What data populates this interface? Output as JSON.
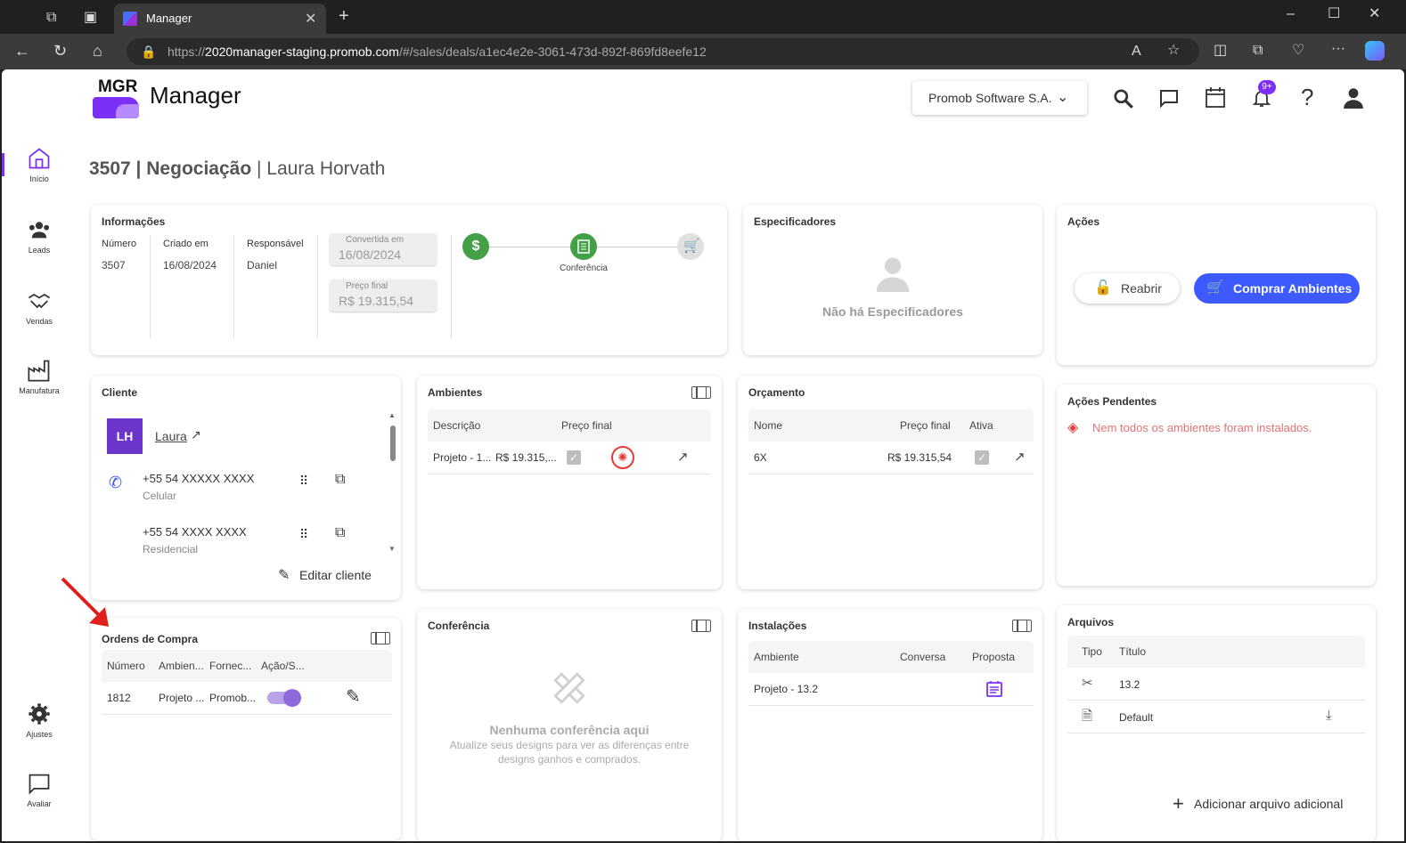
{
  "browser": {
    "tab_title": "Manager",
    "url_prefix": "https://",
    "url_host": "2020manager-staging.promob.com",
    "url_path": "/#/sales/deals/a1ec4e2e-3061-473d-892f-869fd8eefe12"
  },
  "header": {
    "logo_text": "MGR",
    "app_name": "Manager",
    "company": "Promob Software S.A.",
    "notif_badge": "9+"
  },
  "sidebar": {
    "items": [
      {
        "label": "Início"
      },
      {
        "label": "Leads"
      },
      {
        "label": "Vendas"
      },
      {
        "label": "Manufatura"
      },
      {
        "label": "Ajustes"
      },
      {
        "label": "Avaliar"
      }
    ]
  },
  "page": {
    "id": "3507",
    "type": "Negociação",
    "client": "Laura Horvath"
  },
  "info": {
    "title": "Informações",
    "labels": {
      "numero": "Número",
      "criado": "Criado em",
      "responsavel": "Responsável"
    },
    "values": {
      "numero": "3507",
      "criado": "16/08/2024",
      "responsavel": "Daniel"
    },
    "convertida_label": "Convertida em",
    "convertida_value": "16/08/2024",
    "preco_label": "Preço final",
    "preco_value": "R$ 19.315,54",
    "stage_label": "Conferência"
  },
  "especificadores": {
    "title": "Especificadores",
    "empty": "Não há Especificadores"
  },
  "acoes": {
    "title": "Ações",
    "reabrir": "Reabrir",
    "comprar": "Comprar Ambientes"
  },
  "cliente": {
    "title": "Cliente",
    "initials": "LH",
    "name": "Laura",
    "phones": [
      {
        "number": "+55 54 XXXXX XXXX",
        "type": "Celular"
      },
      {
        "number": "+55 54 XXXX XXXX",
        "type": "Residencial"
      }
    ],
    "edit": "Editar cliente"
  },
  "ambientes": {
    "title": "Ambientes",
    "headers": [
      "Descrição",
      "Preço final"
    ],
    "rows": [
      {
        "descricao": "Projeto - 1...",
        "preco": "R$ 19.315,..."
      }
    ]
  },
  "orcamento": {
    "title": "Orçamento",
    "headers": [
      "Nome",
      "Preço final",
      "Ativa"
    ],
    "rows": [
      {
        "nome": "6X",
        "preco": "R$ 19.315,54"
      }
    ]
  },
  "pendentes": {
    "title": "Ações Pendentes",
    "message": "Nem todos os ambientes foram instalados."
  },
  "ordens": {
    "title": "Ordens de Compra",
    "headers": [
      "Número",
      "Ambien...",
      "Fornec...",
      "Ação/S..."
    ],
    "rows": [
      {
        "numero": "1812",
        "ambiente": "Projeto ...",
        "fornecedor": "Promob..."
      }
    ]
  },
  "conferencia": {
    "title": "Conferência",
    "empty_title": "Nenhuma conferência aqui",
    "empty_text_1": "Atualize seus designs para ver as diferenças entre",
    "empty_text_2": "designs ganhos e comprados."
  },
  "instalacoes": {
    "title": "Instalações",
    "headers": [
      "Ambiente",
      "Conversa",
      "Proposta"
    ],
    "rows": [
      {
        "ambiente": "Projeto - 13.2"
      }
    ]
  },
  "arquivos": {
    "title": "Arquivos",
    "headers": [
      "Tipo",
      "Título"
    ],
    "rows": [
      {
        "titulo": "13.2"
      },
      {
        "titulo": "Default"
      }
    ],
    "add": "Adicionar arquivo adicional"
  },
  "colors": {
    "accent": "#7b2ff7",
    "primary_button": "#3d5afe",
    "success": "#43a047",
    "danger": "#e53935",
    "annotation_arrow": "#e0201b"
  }
}
